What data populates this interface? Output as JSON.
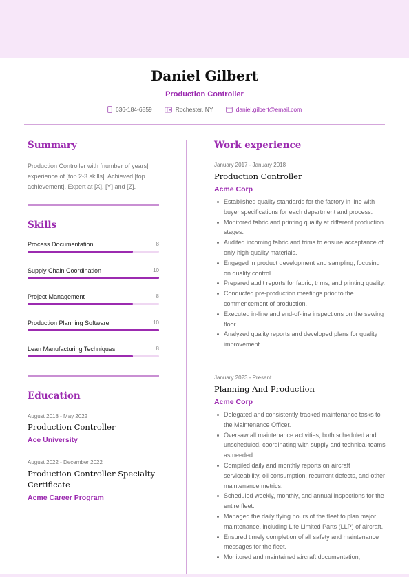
{
  "header": {
    "name": "Daniel Gilbert",
    "role": "Production Controller",
    "contacts": [
      {
        "icon": "phone-icon",
        "text": "636-184-6859"
      },
      {
        "icon": "map-icon",
        "text": "Rochester, NY"
      },
      {
        "icon": "mail-icon",
        "text": "daniel.gilbert@email.com"
      }
    ]
  },
  "colors": {
    "accent": "#9c2bb0",
    "rule": "#d4a6db",
    "band": "#f7e7f9"
  },
  "summary": {
    "heading": "Summary",
    "text": "Production Controller with [number of years] experience of [top 2-3 skills]. Achieved [top achievement]. Expert at [X], [Y] and [Z]."
  },
  "skills": {
    "heading": "Skills",
    "max": 10,
    "items": [
      {
        "name": "Process Documentation",
        "value": 8
      },
      {
        "name": "Supply Chain Coordination",
        "value": 10
      },
      {
        "name": "Project Management",
        "value": 8
      },
      {
        "name": "Production Planning Software",
        "value": 10
      },
      {
        "name": "Lean Manufacturing Techniques",
        "value": 8
      }
    ]
  },
  "education": {
    "heading": "Education",
    "items": [
      {
        "dates": "August 2018 - May 2022",
        "title": "Production Controller",
        "org": "Ace University"
      },
      {
        "dates": "August 2022 - December 2022",
        "title": "Production Controller Specialty Certificate",
        "org": "Acme Career Program"
      }
    ]
  },
  "work": {
    "heading": "Work experience",
    "items": [
      {
        "dates": "January 2017 - January 2018",
        "title": "Production Controller",
        "org": "Acme Corp",
        "bullets": [
          "Established quality standards for the factory in line with buyer specifications for each department and process.",
          "Monitored fabric and printing quality at different production stages.",
          "Audited incoming fabric and trims to ensure acceptance of only high-quality materials.",
          "Engaged in product development and sampling, focusing on quality control.",
          "Prepared audit reports for fabric, trims, and printing quality.",
          "Conducted pre-production meetings prior to the commencement of production.",
          "Executed in-line and end-of-line inspections on the sewing floor.",
          "Analyzed quality reports and developed plans for quality improvement."
        ]
      },
      {
        "dates": "January 2023 - Present",
        "title": "Planning And Production",
        "org": "Acme Corp",
        "bullets": [
          "Delegated and consistently tracked maintenance tasks to the Maintenance Officer.",
          "Oversaw all maintenance activities, both scheduled and unscheduled, coordinating with supply and technical teams as needed.",
          "Compiled daily and monthly reports on aircraft serviceability, oil consumption, recurrent defects, and other maintenance metrics.",
          "Scheduled weekly, monthly, and annual inspections for the entire fleet.",
          "Managed the daily flying hours of the fleet to plan major maintenance, including Life Limited Parts (LLP) of aircraft.",
          "Ensured timely completion of all safety and maintenance messages for the fleet.",
          "Monitored and maintained aircraft documentation,"
        ]
      }
    ]
  }
}
